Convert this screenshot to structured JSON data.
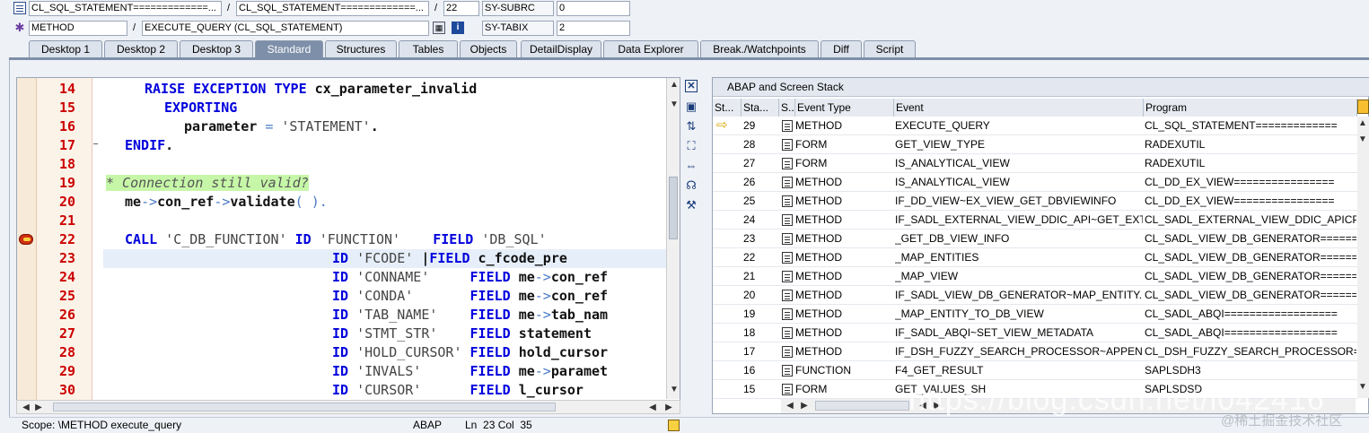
{
  "top": {
    "row1": {
      "f1": "CL_SQL_STATEMENT=============...",
      "sep1": "/",
      "f2": "CL_SQL_STATEMENT=============...",
      "sep2": "/",
      "f3": "22",
      "f4": "SY-SUBRC",
      "f5": "0"
    },
    "row2": {
      "f1": "METHOD",
      "sep1": "/",
      "f2": "EXECUTE_QUERY (CL_SQL_STATEMENT)",
      "f4": "SY-TABIX",
      "f5": "2"
    }
  },
  "tabs": [
    "Desktop 1",
    "Desktop 2",
    "Desktop 3",
    "Standard",
    "Structures",
    "Tables",
    "Objects",
    "DetailDisplay",
    "Data Explorer",
    "Break./Watchpoints",
    "Diff",
    "Script"
  ],
  "active_tab": "Standard",
  "code": {
    "line_numbers": [
      "14",
      "15",
      "16",
      "17",
      "18",
      "19",
      "20",
      "21",
      "22",
      "23",
      "24",
      "25",
      "26",
      "27",
      "28",
      "29",
      "30"
    ],
    "l14": {
      "a": "RAISE EXCEPTION TYPE",
      "b": " cx_parameter_invalid"
    },
    "l15": {
      "a": "EXPORTING"
    },
    "l16": {
      "a": "parameter ",
      "b": "=",
      "c": " 'STATEMENT'",
      "d": "."
    },
    "l17": {
      "a": "ENDIF",
      "b": "."
    },
    "l19": {
      "a": "* Connection still valid?"
    },
    "l20": {
      "a": "me",
      "b": "->",
      "c": "con_ref",
      "d": "->",
      "e": "validate",
      "f": "( ).",
      "g": ""
    },
    "l22": {
      "a": "CALL",
      "b": " 'C_DB_FUNCTION' ",
      "c": "ID",
      "d": " 'FUNCTION'    ",
      "e": "FIELD",
      "f": " 'DB_SQL'"
    },
    "l23": {
      "c": "ID",
      "d": " 'FCODE'",
      "cursor": " |",
      "e": "FIELD",
      "f": " c_fcode_pre"
    },
    "l24": {
      "c": "ID",
      "d": " 'CONNAME'     ",
      "e": "FIELD",
      "f": " me",
      "g": "->",
      "h": "con_ref"
    },
    "l25": {
      "c": "ID",
      "d": " 'CONDA'       ",
      "e": "FIELD",
      "f": " me",
      "g": "->",
      "h": "con_ref"
    },
    "l26": {
      "c": "ID",
      "d": " 'TAB_NAME'    ",
      "e": "FIELD",
      "f": " me",
      "g": "->",
      "h": "tab_nam"
    },
    "l27": {
      "c": "ID",
      "d": " 'STMT_STR'    ",
      "e": "FIELD",
      "f": " statement"
    },
    "l28": {
      "c": "ID",
      "d": " 'HOLD_CURSOR' ",
      "e": "FIELD",
      "f": " hold_cursor"
    },
    "l29": {
      "c": "ID",
      "d": " 'INVALS'      ",
      "e": "FIELD",
      "f": " me",
      "g": "->",
      "h": "paramet"
    },
    "l30": {
      "c": "ID",
      "d": " 'CURSOR'      ",
      "e": "FIELD",
      "f": " l_cursor"
    }
  },
  "stack": {
    "title": "ABAP and Screen Stack",
    "headers": [
      "St...",
      "Sta...",
      "S...",
      "Event Type",
      "Event",
      "Program"
    ],
    "rows": [
      {
        "lvl": "29",
        "type": "METHOD",
        "event": "EXECUTE_QUERY",
        "prog": "CL_SQL_STATEMENT=============",
        "current": true
      },
      {
        "lvl": "28",
        "type": "FORM",
        "event": "GET_VIEW_TYPE",
        "prog": "RADEXUTIL"
      },
      {
        "lvl": "27",
        "type": "FORM",
        "event": "IS_ANALYTICAL_VIEW",
        "prog": "RADEXUTIL"
      },
      {
        "lvl": "26",
        "type": "METHOD",
        "event": "IS_ANALYTICAL_VIEW",
        "prog": "CL_DD_EX_VIEW================"
      },
      {
        "lvl": "25",
        "type": "METHOD",
        "event": "IF_DD_VIEW~EX_VIEW_GET_DBVIEWINFO",
        "prog": "CL_DD_EX_VIEW================"
      },
      {
        "lvl": "24",
        "type": "METHOD",
        "event": "IF_SADL_EXTERNAL_VIEW_DDIC_API~GET_EXT...",
        "prog": "CL_SADL_EXTERNAL_VIEW_DDIC_APICP"
      },
      {
        "lvl": "23",
        "type": "METHOD",
        "event": "_GET_DB_VIEW_INFO",
        "prog": "CL_SADL_VIEW_DB_GENERATOR======C"
      },
      {
        "lvl": "22",
        "type": "METHOD",
        "event": "_MAP_ENTITIES",
        "prog": "CL_SADL_VIEW_DB_GENERATOR======C"
      },
      {
        "lvl": "21",
        "type": "METHOD",
        "event": "_MAP_VIEW",
        "prog": "CL_SADL_VIEW_DB_GENERATOR======C"
      },
      {
        "lvl": "20",
        "type": "METHOD",
        "event": "IF_SADL_VIEW_DB_GENERATOR~MAP_ENTITY...",
        "prog": "CL_SADL_VIEW_DB_GENERATOR======C"
      },
      {
        "lvl": "19",
        "type": "METHOD",
        "event": "_MAP_ENTITY_TO_DB_VIEW",
        "prog": "CL_SADL_ABQI=================="
      },
      {
        "lvl": "18",
        "type": "METHOD",
        "event": "IF_SADL_ABQI~SET_VIEW_METADATA",
        "prog": "CL_SADL_ABQI=================="
      },
      {
        "lvl": "17",
        "type": "METHOD",
        "event": "IF_DSH_FUZZY_SEARCH_PROCESSOR~APPEND_...",
        "prog": "CL_DSH_FUZZY_SEARCH_PROCESSOR=CP"
      },
      {
        "lvl": "16",
        "type": "FUNCTION",
        "event": "F4_GET_RESULT",
        "prog": "SAPLSDH3"
      },
      {
        "lvl": "15",
        "type": "FORM",
        "event": "GET_VALUES_SH",
        "prog": "SAPLSDSD"
      }
    ]
  },
  "status": {
    "scope": "Scope: \\METHOD execute_query",
    "lang": "ABAP",
    "pos": "Ln  23 Col  35"
  },
  "watermark": {
    "url": "https://blog.csdn.net/i042416",
    "credit": "@稀土掘金技术社区"
  },
  "colors": {
    "keyword": "#0000dd",
    "linenum": "#cc0000",
    "comment_bg": "#c6f7a8",
    "active_tab": "#7d8fa9",
    "breakpoint": "#d03010"
  }
}
